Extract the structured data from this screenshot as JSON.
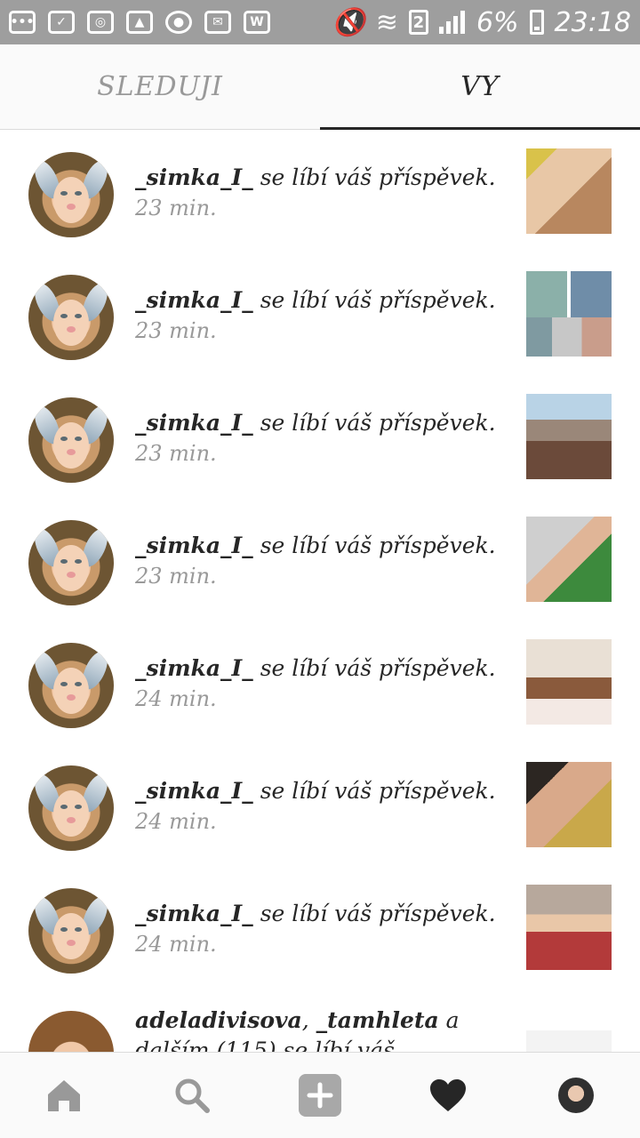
{
  "status_bar": {
    "battery": "6%",
    "time": "23:18",
    "sim_slot": "2",
    "notification_icons": [
      "messages-icon",
      "file-check-icon",
      "instagram-icon",
      "gallery-icon",
      "wechat-icon",
      "mail-icon",
      "w-app-icon"
    ]
  },
  "tabs": {
    "following_label": "SLEDUJI",
    "you_label": "VY",
    "active": "VY"
  },
  "notifications": [
    {
      "username": "_simka_I_",
      "action": "se líbí váš příspěvek.",
      "time": "23 min."
    },
    {
      "username": "_simka_I_",
      "action": "se líbí váš příspěvek.",
      "time": "23 min."
    },
    {
      "username": "_simka_I_",
      "action": "se líbí váš příspěvek.",
      "time": "23 min."
    },
    {
      "username": "_simka_I_",
      "action": "se líbí váš příspěvek.",
      "time": "23 min."
    },
    {
      "username": "_simka_I_",
      "action": "se líbí váš příspěvek.",
      "time": "24 min."
    },
    {
      "username": "_simka_I_",
      "action": "se líbí váš příspěvek.",
      "time": "24 min."
    },
    {
      "username": "_simka_I_",
      "action": "se líbí váš příspěvek.",
      "time": "24 min."
    }
  ],
  "last_notification": {
    "user1": "adeladivisova",
    "sep": ",",
    "user2": "_tamhleta",
    "and": "a",
    "others": "dalším (115) se líbí váš"
  },
  "bottom_nav": {
    "items": [
      "home-icon",
      "search-icon",
      "add-post-icon",
      "activity-heart-icon",
      "profile-avatar"
    ],
    "icon_color": "#999999",
    "active_color": "#262626"
  }
}
